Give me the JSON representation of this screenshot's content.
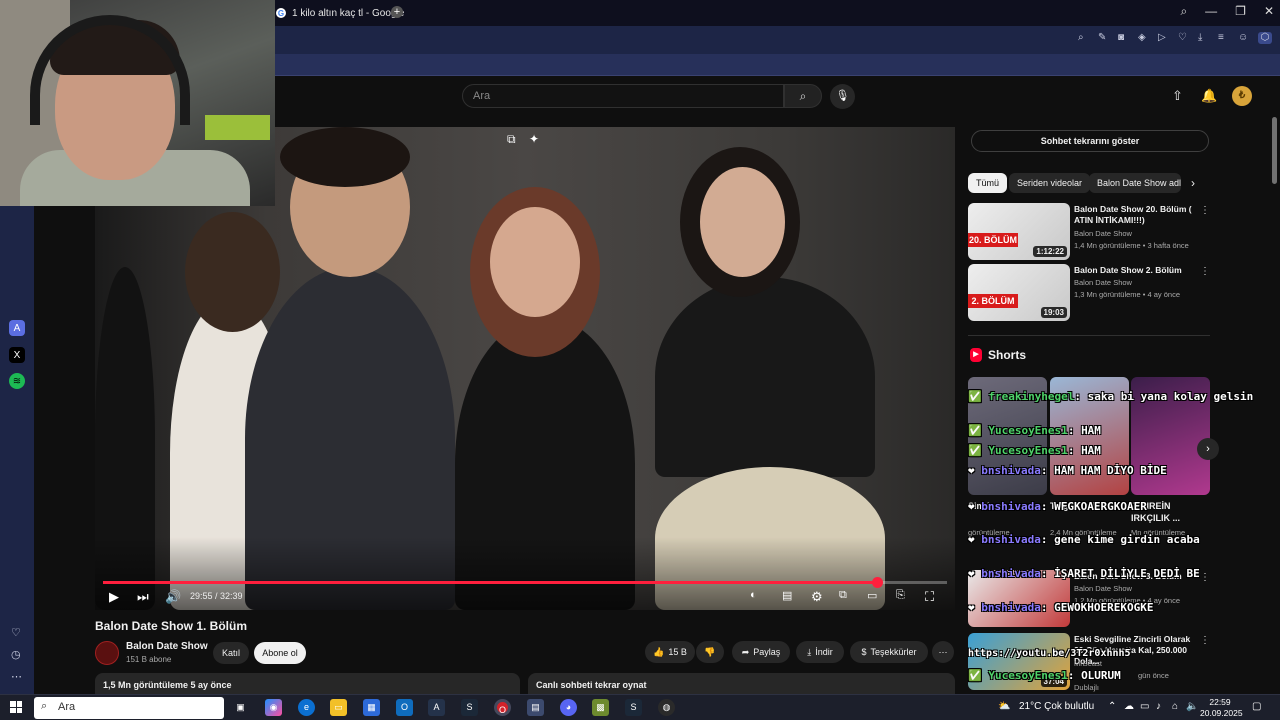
{
  "browser": {
    "tab_title": "1 kilo altın kaç tl - Google",
    "new_tab": "+",
    "window_controls": [
      "⌕",
      "—",
      "❐",
      "✕"
    ]
  },
  "youtube": {
    "search_placeholder": "Ara",
    "video": {
      "title": "Balon Date Show 1. Bölüm",
      "time": "29:55 / 32:39",
      "progress": 0.917
    },
    "channel": {
      "name": "Balon Date Show",
      "subs": "151 B abone",
      "join": "Katıl",
      "subscribe": "Abone ol"
    },
    "actions": {
      "likes": "15 B",
      "share": "Paylaş",
      "download": "İndir",
      "thanks": "Teşekkürler",
      "more": "⋯"
    },
    "description_meta": "1,5 Mn görüntüleme  5 ay önce",
    "chat_replay_play": "Canlı sohbeti tekrar oynat",
    "chat_replay_show": "Sohbet tekrarını göster",
    "chips": [
      "Tümü",
      "Seriden videolar",
      "Balon Date Show adlı"
    ],
    "recommendations": [
      {
        "title": "Balon Date Show 20. Bölüm ( ATIN İNTİKAMI!!!)",
        "channel": "Balon Date Show",
        "meta": "1,4 Mn görüntüleme • 3 hafta önce",
        "badge": "20. BÖLÜM",
        "duration": "1:12:22"
      },
      {
        "title": "Balon Date Show 2. Bölüm",
        "channel": "Balon Date Show",
        "meta": "1,3 Mn görüntüleme • 4 ay önce",
        "badge": "2. BÖLÜM",
        "duration": "19:03"
      },
      {
        "title": "Balon Date Show 3. Bölüm",
        "channel": "Balon Date Show",
        "meta": "1,2 Mn görüntüleme • 4 ay önce",
        "badge": "",
        "duration": ""
      },
      {
        "title": "Eski Sevgiline Zincirli Olarak 30 Gün Hayatta Kal, 250.000 Dola...",
        "channel": "MrBeast",
        "meta": "gün önce",
        "badge": "",
        "duration": "37:04"
      }
    ],
    "shorts_heading": "Shorts",
    "shorts": [
      {
        "title": "Sim bey",
        "views": "görüntüleme"
      },
      {
        "title": "Tolga Çevik",
        "views": "2,4 Mn görüntüleme"
      },
      {
        "title": "JAHREİN IRKÇILIK ...",
        "views": "Mn görüntüleme"
      }
    ],
    "dubbed": "Dublajlı"
  },
  "chat_overlay": [
    {
      "user": "freakinyhegel",
      "text": "saka bi yana kolay gelsin"
    },
    {
      "user": "YucesoyEnes1",
      "text": "HAM"
    },
    {
      "user": "YucesoyEnes1",
      "text": "HAM"
    },
    {
      "user": "bnshivada",
      "text": "HAM HAM DİYO BİDE"
    },
    {
      "user": "bnshivada",
      "text": "WFGKOAERGKOAER"
    },
    {
      "user": "bnshivada",
      "text": "gene kime girdin acaba"
    },
    {
      "user": "bnshivada",
      "text": "İŞARET DİLİYLE DEDİ BE"
    },
    {
      "user": "bnshivada",
      "text": "GEWOKHOEREKOGKE"
    },
    {
      "user": "",
      "text": "https://youtu.be/3T2r0xhnh5"
    },
    {
      "user": "YucesoyEnes1",
      "text": "OLURUM"
    }
  ],
  "taskbar": {
    "search": "Ara",
    "weather": "21°C  Çok bulutlu",
    "time": "22:59",
    "date": "20.09.2025"
  },
  "colors": {
    "progress": "#ff1f3d",
    "browser_toolbar": "#1d2546",
    "page_bg": "#0f0f0f"
  }
}
